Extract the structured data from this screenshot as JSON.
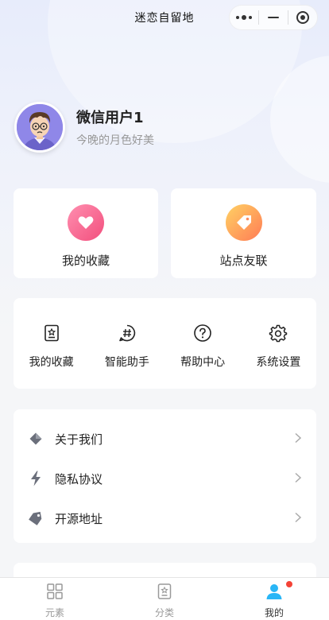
{
  "window": {
    "title": "迷恋自留地"
  },
  "profile": {
    "username": "微信用户1",
    "signature": "今晚的月色好美"
  },
  "big_entries": [
    {
      "label": "我的收藏",
      "icon": "heart-icon",
      "color": "#f24f7d"
    },
    {
      "label": "站点友联",
      "icon": "tag-icon",
      "color": "#ff7b55"
    }
  ],
  "tools": [
    {
      "label": "我的收藏",
      "icon": "badge-icon"
    },
    {
      "label": "智能助手",
      "icon": "hash-icon"
    },
    {
      "label": "帮助中心",
      "icon": "question-icon"
    },
    {
      "label": "系统设置",
      "icon": "gear-icon"
    }
  ],
  "menu": [
    {
      "label": "关于我们",
      "icon": "diamond-icon"
    },
    {
      "label": "隐私协议",
      "icon": "lightning-icon"
    },
    {
      "label": "开源地址",
      "icon": "tag-icon"
    }
  ],
  "tabbar": {
    "tabs": [
      {
        "label": "元素",
        "icon": "grid-icon",
        "active": false
      },
      {
        "label": "分类",
        "icon": "badge-icon",
        "active": false
      },
      {
        "label": "我的",
        "icon": "user-icon",
        "active": true
      }
    ],
    "accent": "#29b6f6"
  }
}
